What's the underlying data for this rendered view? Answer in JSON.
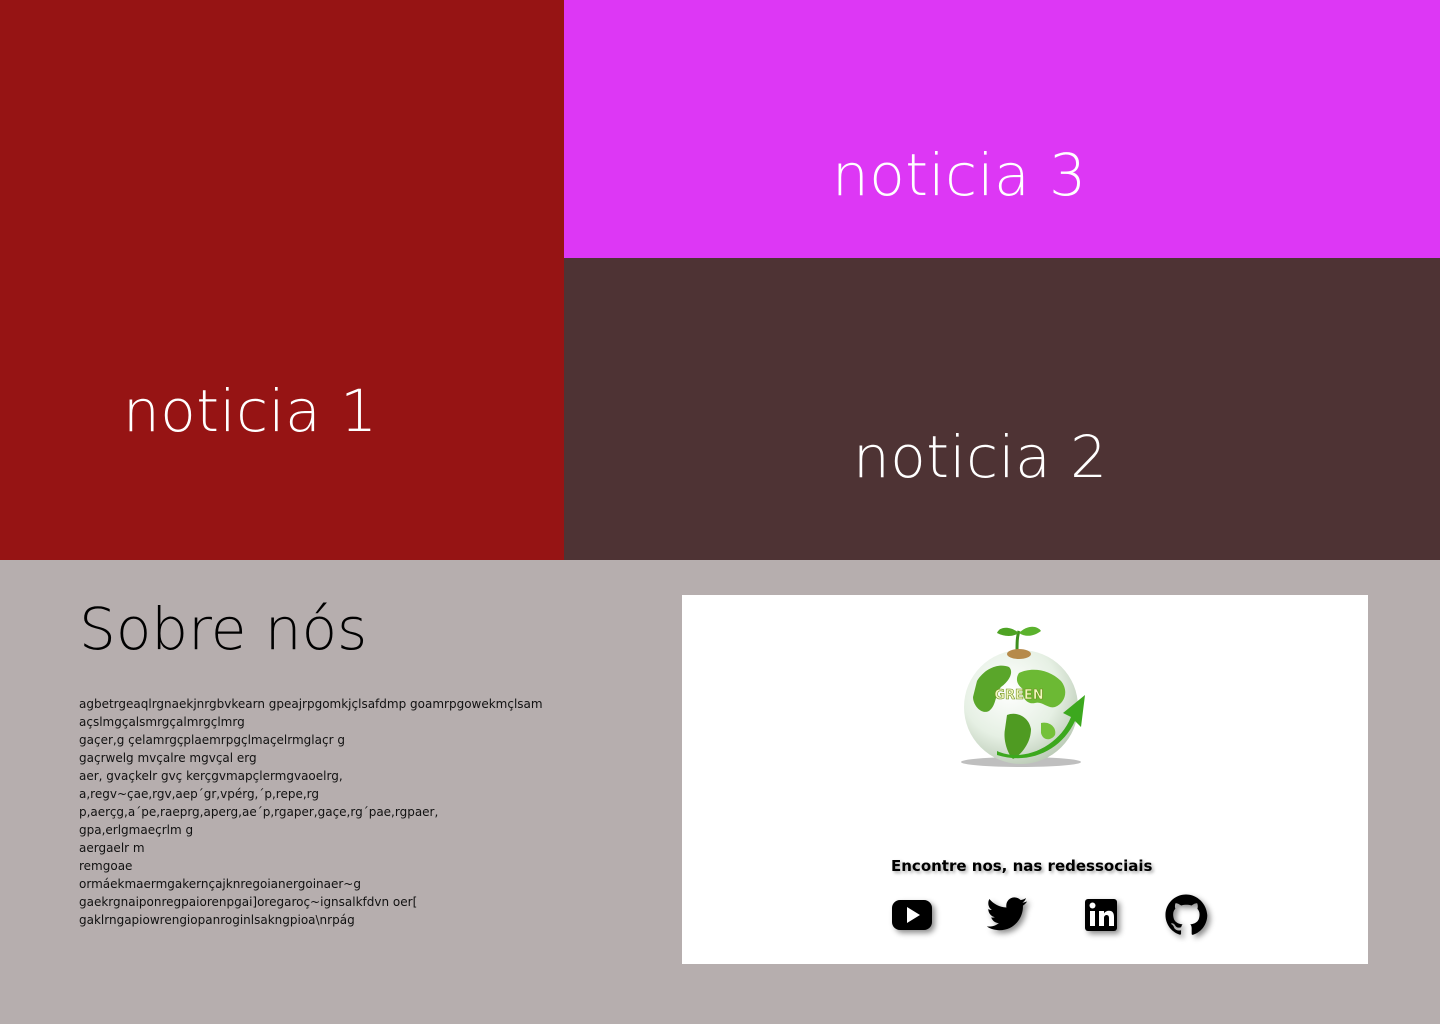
{
  "news": {
    "item1": "noticia 1",
    "item2": "noticia 2",
    "item3": "noticia 3"
  },
  "colors": {
    "news1": "#961414",
    "news2": "#4e3334",
    "news3": "#dd37f5",
    "about_bg": "#b6aeae"
  },
  "about": {
    "title": "Sobre nós",
    "lines": [
      "agbetrgeaqlrgnaekjnrgbvkearn gpeajrpgomkjçlsafdmp goamrpgowekmçlsam",
      "açslmgçalsmrgçalmrgçlmrg",
      "gaçer,g çelamrgçplaemrpgçlmaçelrmglaçr g",
      "gaçrwelg mvçalre mgvçal erg",
      "aer, gvaçkelr gvç kerçgvmapçlermgvaoelrg,",
      "a,regv~çae,rgv,aep´gr,vpérg,´p,repe,rg",
      "p,aerçg,a´pe,raeprg,aperg,ae´p,rgaper,gaçe,rg´pae,rgpaer,",
      "gpa,erlgmaeçrlm g",
      "aergaelr m",
      "remgoae",
      "ormáekmaermgakernçajknregoianergoinaer~g",
      "gaekrgnaiponregpaiorenpgai]oregaroç~ignsalkfdvn oer[",
      "gaklrngapiowrengiopanroginlsakngpioa\\nrpág"
    ]
  },
  "card": {
    "logo_text": "GREEN",
    "social_heading": "Encontre nos, nas redessociais",
    "social_icons": [
      "youtube-icon",
      "twitter-icon",
      "linkedin-icon",
      "github-icon"
    ]
  }
}
